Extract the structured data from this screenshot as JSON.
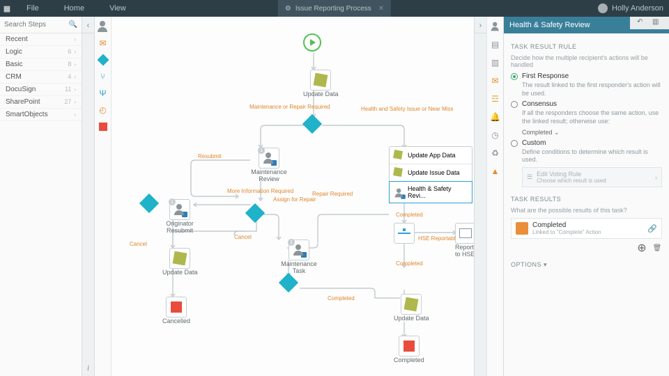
{
  "topbar": {
    "menu": [
      "File",
      "Home",
      "View"
    ],
    "tab": "Issue Reporting Process",
    "user": "Holly Anderson"
  },
  "search": {
    "placeholder": "Search Steps"
  },
  "categories": [
    {
      "label": "Recent",
      "count": ""
    },
    {
      "label": "Logic",
      "count": "6"
    },
    {
      "label": "Basic",
      "count": "8"
    },
    {
      "label": "CRM",
      "count": "4"
    },
    {
      "label": "DocuSign",
      "count": "11"
    },
    {
      "label": "SharePoint",
      "count": "27"
    },
    {
      "label": "SmartObjects",
      "count": ""
    }
  ],
  "nodes": {
    "updateData1": "Update Data",
    "maintReview": "Maintenance Review",
    "origResubmit": "Originator Resubmit",
    "updateData2": "Update Data",
    "cancelled": "Cancelled",
    "maintTask": "Maintenance Task",
    "updateAppData": "Update App Data",
    "updateIssueData": "Update Issue Data",
    "hsReview": "Health & Safety Revi...",
    "reportHSE": "Report to HSE",
    "updateData3": "Update Data",
    "completed": "Completed"
  },
  "edges": {
    "maintRepair": "Maintenance or Repair Required",
    "hsIssue": "Health and Safety Issue or Near Miss",
    "resubmit": "Resubmit",
    "moreInfo": "More Information Required",
    "assignRepair": "Assign for Repair",
    "repairRequired": "Repair Required",
    "cancel1": "Cancel",
    "cancel2": "Cancel",
    "hseReportable": "HSE Reportable",
    "completed1": "Completed",
    "completed2": "Completed",
    "completed3": "Completed"
  },
  "right": {
    "title": "Health & Safety Review",
    "sect1": "TASK RESULT RULE",
    "hint1": "Decide how the multiple recipient's actions will be handled",
    "r1": {
      "label": "First Response",
      "sub": "The result linked to the first responder's action will be used."
    },
    "r2": {
      "label": "Consensus",
      "sub": "If all the responders choose the same action, use the linked result; otherwise use:",
      "sel": "Completed"
    },
    "r3": {
      "label": "Custom",
      "sub": "Define conditions to determine which result is used."
    },
    "voting": {
      "title": "Edit Voting Rule",
      "sub": "Choose which result is used"
    },
    "sect2": "TASK RESULTS",
    "hint2": "What are the possible results of this task?",
    "result": {
      "title": "Completed",
      "sub": "Linked to \"Complete\" Action"
    },
    "options": "OPTIONS"
  }
}
